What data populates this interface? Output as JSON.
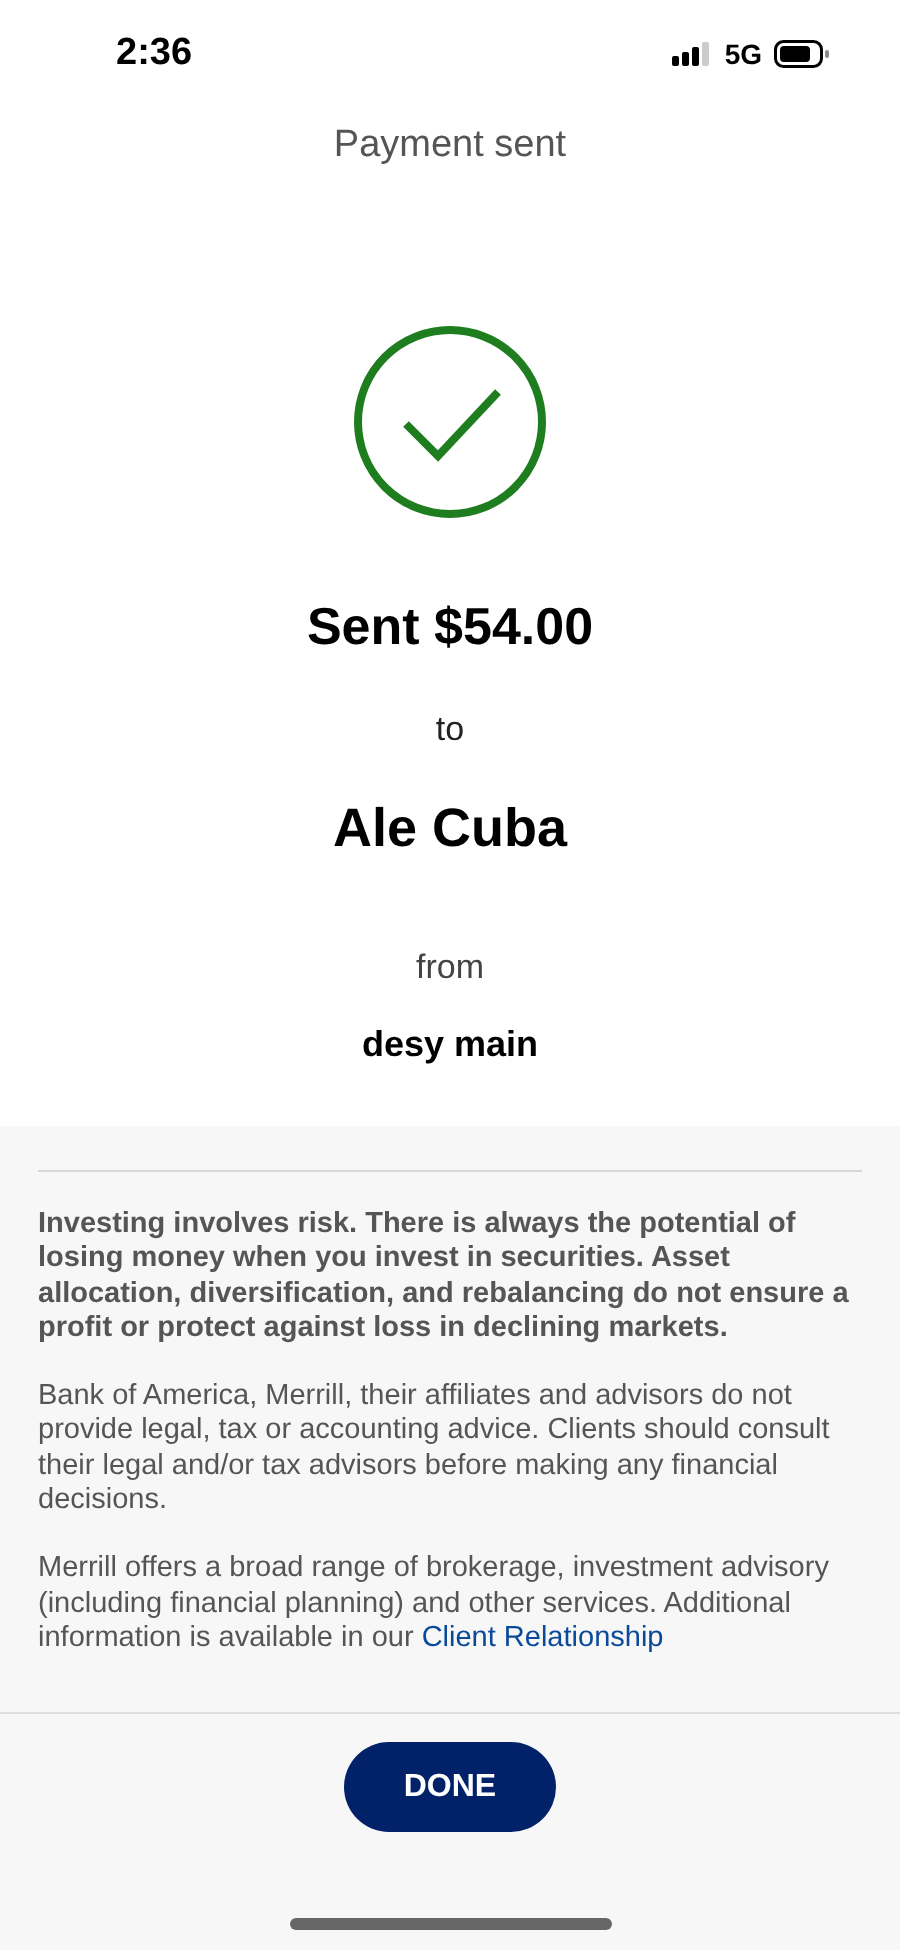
{
  "status_bar": {
    "time": "2:36",
    "network": "5G"
  },
  "header": {
    "title": "Payment sent"
  },
  "confirmation": {
    "amount": "Sent $54.00",
    "to_label": "to",
    "recipient": "Ale Cuba",
    "from_label": "from",
    "account": "desy main"
  },
  "disclaimer": {
    "risk_text": "Investing involves risk. There is always the potential of losing money when you invest in securities. Asset allocation, diversification, and rebalancing do not ensure a profit or protect against loss in declining markets.",
    "advice_text": "Bank of America, Merrill, their affiliates and advisors do not provide legal, tax or accounting advice. Clients should consult their legal and/or tax advisors before making any financial decisions.",
    "services_text": "Merrill offers a broad range of brokerage, investment advisory (including financial planning) and other services. Additional information is available in our",
    "services_link": "Client Relationship"
  },
  "footer": {
    "button": "DONE"
  }
}
